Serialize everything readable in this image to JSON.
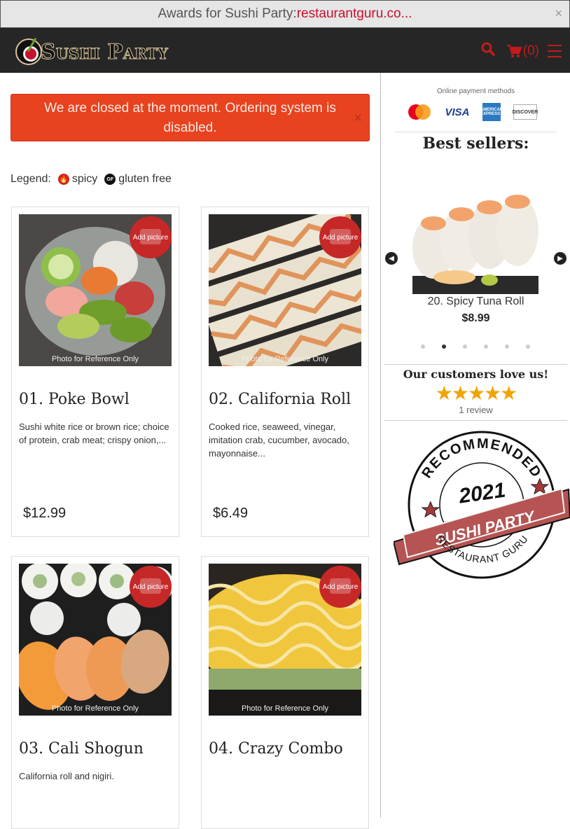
{
  "award_bar": {
    "text": "Awards for Sushi Party:",
    "link": "restaurantguru.co...",
    "close": "×"
  },
  "header": {
    "logo_text": "Sushi Party",
    "cart_count": "(0)",
    "icons": [
      "search-icon",
      "cart-icon",
      "menu-icon"
    ]
  },
  "alert": {
    "text": "We are closed at the moment. Ordering system is disabled.",
    "close": "×"
  },
  "legend": {
    "label": "Legend:",
    "spicy": "spicy",
    "gluten_free": "gluten free",
    "gf_mark": "GF"
  },
  "products": [
    {
      "title": "01. Poke Bowl",
      "desc": "Sushi white rice or brown rice; choice of protein, crab meat; crispy onion,...",
      "price": "$12.99",
      "add_picture": "Add picture",
      "ref": "Photo for Reference Only"
    },
    {
      "title": "02. California Roll",
      "desc": "Cooked rice, seaweed, vinegar, imitation crab, cucumber, avocado, mayonnaise...",
      "price": "$6.49",
      "add_picture": "Add picture",
      "ref": "Photo for Reference Only"
    },
    {
      "title": "03. Cali Shogun",
      "desc": "California roll and nigiri.",
      "price": "",
      "add_picture": "Add picture",
      "ref": "Photo for Reference Only"
    },
    {
      "title": "04. Crazy Combo",
      "desc": "",
      "price": "",
      "add_picture": "Add picture",
      "ref": "Photo for Reference Only"
    }
  ],
  "sidebar": {
    "payment_label": "Online payment methods",
    "payment_methods": [
      "mastercard",
      "VISA",
      "AMERICAN EXPRESS",
      "DISCOVER"
    ],
    "best_sellers_title": "Best sellers:",
    "carousel": {
      "item_name": "20. Spicy Tuna Roll",
      "item_price": "$8.99",
      "prev": "Previous",
      "next": "Next",
      "slides": 6,
      "active_slide": 2
    },
    "love_title": "Our customers love us!",
    "stars": "★★★★★",
    "rating": 5,
    "reviews": "1 review",
    "seal": {
      "top": "RECOMMENDED",
      "year": "2021",
      "name": "SUSHI PARTY",
      "bottom": "RESTAURANT GURU"
    }
  }
}
